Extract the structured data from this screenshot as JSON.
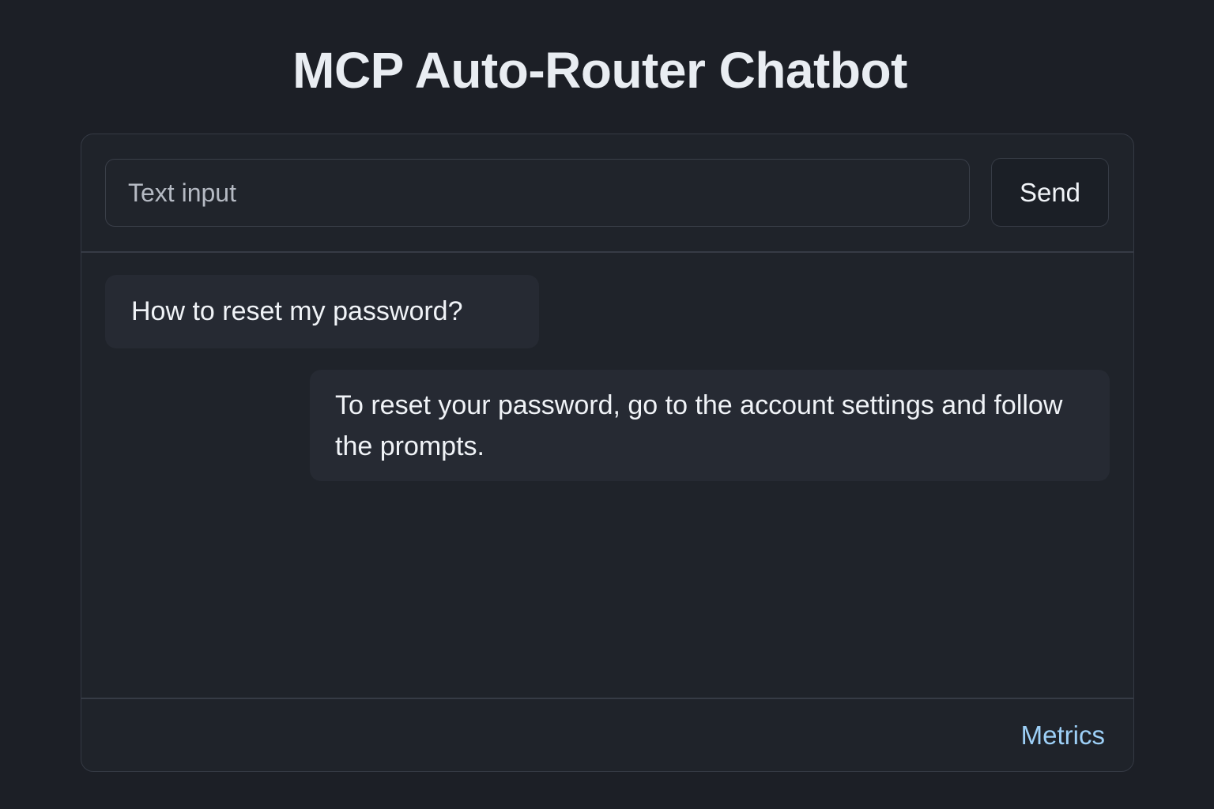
{
  "header": {
    "title": "MCP Auto-Router Chatbot"
  },
  "composer": {
    "placeholder": "Text input",
    "value": "",
    "send_label": "Send"
  },
  "messages": [
    {
      "role": "user",
      "text": "How to reset my password?"
    },
    {
      "role": "assistant",
      "text": "To reset your password, go to the account settings and follow the prompts."
    }
  ],
  "footer": {
    "metrics_label": "Metrics"
  },
  "colors": {
    "background": "#1c1f26",
    "card": "#1f232a",
    "bubble": "#262a33",
    "link": "#9dd0f7"
  }
}
